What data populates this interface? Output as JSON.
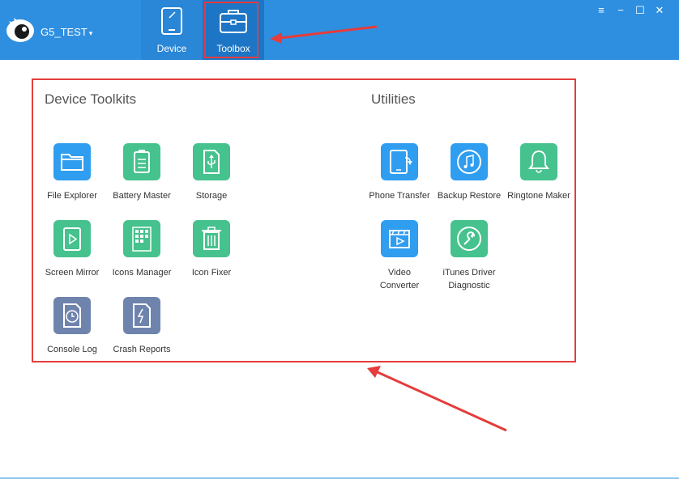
{
  "header": {
    "device_name": "G5_TEST",
    "caret": "▾",
    "tabs": [
      {
        "label": "Device",
        "icon": "tablet-icon"
      },
      {
        "label": "Toolbox",
        "icon": "toolbox-icon",
        "active": true
      }
    ],
    "window_controls": {
      "hamburger": "≡",
      "minimize": "−",
      "maximize": "☐",
      "close": "✕"
    }
  },
  "sections": {
    "device_toolkits": {
      "title": "Device Toolkits",
      "tools": [
        {
          "label": "File Explorer",
          "icon": "folder-icon",
          "color": "blue"
        },
        {
          "label": "Battery Master",
          "icon": "battery-icon",
          "color": "green"
        },
        {
          "label": "Storage",
          "icon": "usb-storage-icon",
          "color": "green"
        },
        {
          "label": "Screen Mirror",
          "icon": "play-icon",
          "color": "green"
        },
        {
          "label": "Icons Manager",
          "icon": "grid-icon",
          "color": "green"
        },
        {
          "label": "Icon Fixer",
          "icon": "trash-icon",
          "color": "green"
        },
        {
          "label": "Console Log",
          "icon": "clock-file-icon",
          "color": "slate"
        },
        {
          "label": "Crash Reports",
          "icon": "lightning-file-icon",
          "color": "slate"
        }
      ]
    },
    "utilities": {
      "title": "Utilities",
      "tools": [
        {
          "label": "Phone Transfer",
          "icon": "phone-transfer-icon",
          "color": "blue"
        },
        {
          "label": "Backup Restore",
          "icon": "music-note-icon",
          "color": "blue"
        },
        {
          "label": "Ringtone Maker",
          "icon": "bell-icon",
          "color": "green"
        },
        {
          "label": "Video Converter",
          "icon": "video-clapper-icon",
          "color": "blue"
        },
        {
          "label": "iTunes Driver Diagnostic",
          "icon": "wrench-icon",
          "color": "green"
        }
      ]
    }
  },
  "colors": {
    "header": "#2e8fe0",
    "tile_green": "#45c28d",
    "tile_blue": "#2f9df0",
    "tile_slate": "#6f84ad",
    "annotation": "#e53c3c"
  }
}
